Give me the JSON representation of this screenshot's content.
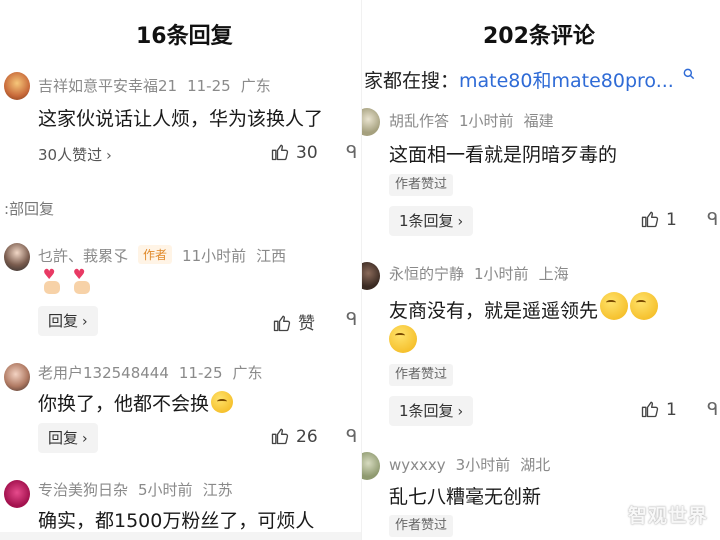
{
  "left": {
    "title": "16条回复",
    "comments": [
      {
        "user": "吉祥如意平安幸福21",
        "date": "11-25",
        "region": "广东",
        "text": "这家伙说话让人烦，华为该换人了",
        "likes_text": "30人赞过",
        "likes": "30"
      },
      {
        "user": "乜許、莪累孓",
        "tag": "作者",
        "date": "11小时前",
        "region": "江西",
        "reply_label": "回复",
        "likes": "赞"
      },
      {
        "user": "老用户132548444",
        "date": "11-25",
        "region": "广东",
        "text": "你换了，他都不会换",
        "reply_label": "回复",
        "likes": "26"
      },
      {
        "user": "专治美狗日杂",
        "date": "5小时前",
        "region": "江苏",
        "text": "确实，都1500万粉丝了，可烦人"
      }
    ],
    "all_replies": ":部回复"
  },
  "right": {
    "title": "202条评论",
    "search_prefix": "家都在搜：",
    "search_link": "mate80和mate80pro...",
    "comments": [
      {
        "user": "胡乱作答",
        "date": "1小时前",
        "region": "福建",
        "text": "这面相一看就是阴暗歹毒的",
        "author_liked": "作者赞过",
        "reply_label": "1条回复",
        "likes": "1"
      },
      {
        "user": "永恒的宁静",
        "date": "1小时前",
        "region": "上海",
        "text": "友商没有，就是遥遥领先",
        "author_liked": "作者赞过",
        "reply_label": "1条回复",
        "likes": "1"
      },
      {
        "user": "wyxxxy",
        "date": "3小时前",
        "region": "湖北",
        "text": "乱七八糟毫无创新",
        "author_liked": "作者赞过"
      }
    ]
  },
  "watermark": "智观世界",
  "colors": {
    "link": "#2f6bd6",
    "author_tag": "#e08a2b",
    "meta": "#8a8a8a"
  }
}
